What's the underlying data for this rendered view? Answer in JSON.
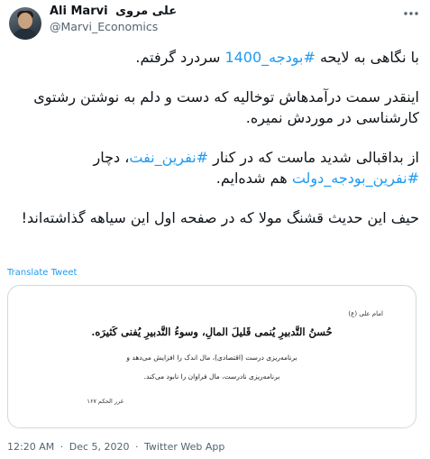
{
  "author": {
    "name_latin": "Ali Marvi",
    "name_persian": "علی مروی",
    "handle": "@Marvi_Economics",
    "avatar": "avatar-photo"
  },
  "more_icon": "more-options-icon",
  "tweet": {
    "p1": {
      "before": "با نگاهی به لایحه ",
      "tag": "#بودجه_1400",
      "after": " سردرد گرفتم."
    },
    "p2": "اینقدر سمت درآمدهاش توخالیه که دست و دلم به نوشتن رشتوی کارشناسی در موردش نمیره.",
    "p3": {
      "before": "از بداقبالی شدید ماست که در کنار ",
      "tag1": "#نفرین_نفت",
      "mid": "، دچار ",
      "tag2": "#نفرین_بودجه_دولت",
      "after": " هم شده‌ایم."
    },
    "p4": "حیف این حدیث قشنگ مولا که در صفحه اول این سیاهه گذاشته‌اند!"
  },
  "translate_label": "Translate Tweet",
  "card": {
    "source": "امام علی (ع)",
    "arabic": "حُسنُ التَّدبیرِ یُنمی قَلیلَ المالِ، وسوءُ التَّدبیرِ یُفنی کَثیرَه.",
    "line1": "برنامه‌ریزی درست (اقتصادی)، مال اندک را افزایش می‌دهد و",
    "line2": "برنامه‌ریزی نادرست، مال فراوان را نابود می‌کند.",
    "reference": "غرر الحکم ۱۶۷"
  },
  "meta": {
    "time": "12:20 AM",
    "sep1": "·",
    "date": "Dec 5, 2020",
    "sep2": "·",
    "client": "Twitter Web App"
  },
  "colors": {
    "link": "#1d9bf0",
    "secondary": "#536471",
    "border": "#cfd9de"
  }
}
